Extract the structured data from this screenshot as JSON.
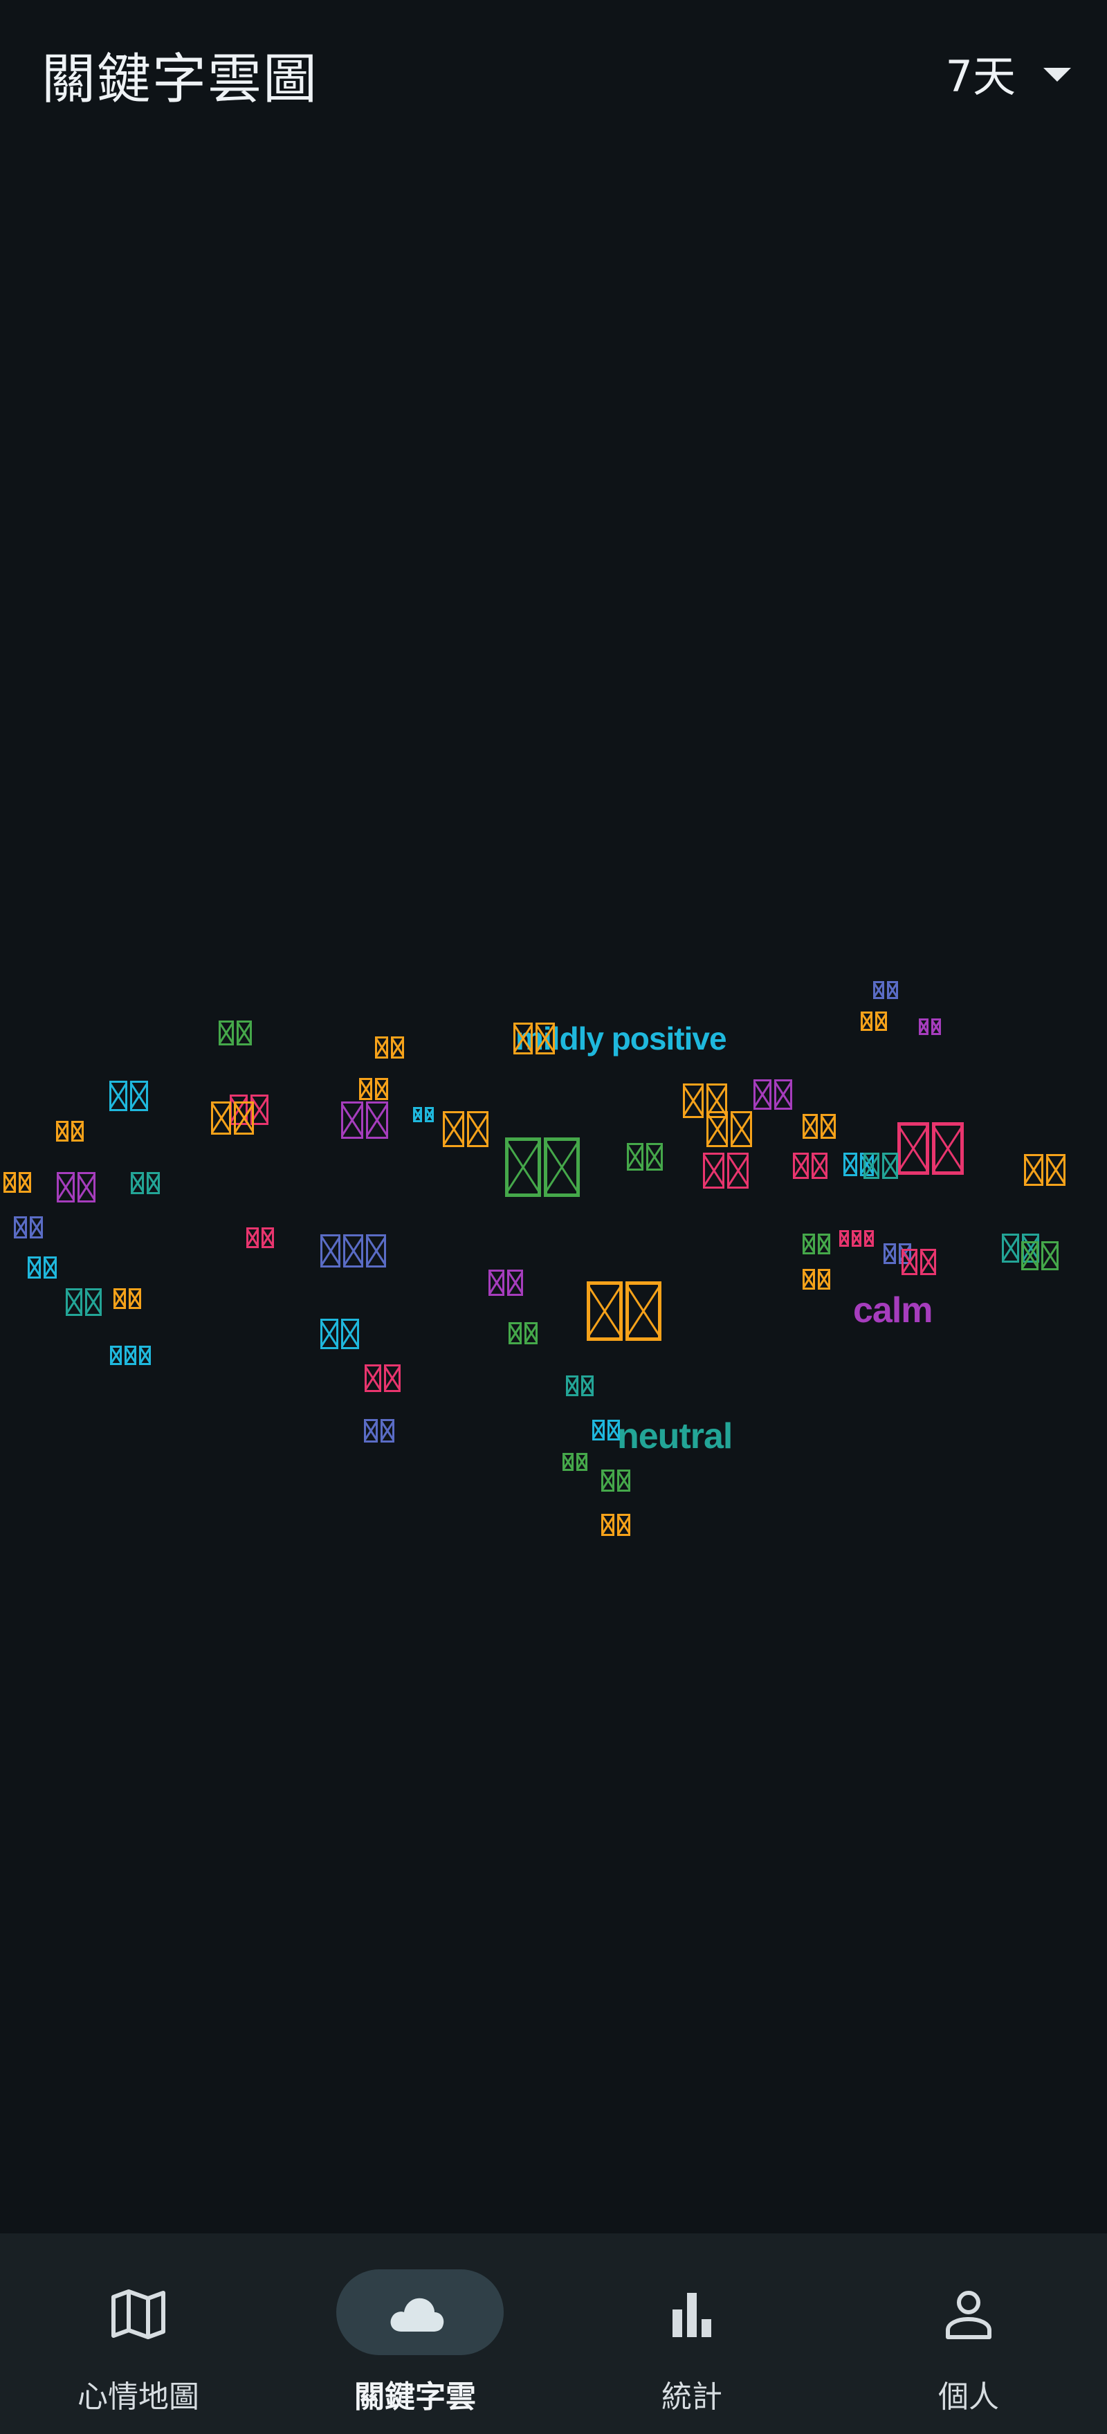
{
  "header": {
    "title": "關鍵字雲圖",
    "range_label": "7天"
  },
  "colors": {
    "background": "#0e1317",
    "nav_background": "#192024",
    "nav_active_pill": "#304048",
    "pink": "#e8356e",
    "orange": "#f6a21a",
    "green": "#45a84a",
    "teal": "#23a597",
    "cyan": "#1fb8dd",
    "purple": "#a63dbd",
    "indigo": "#5a6cc5"
  },
  "word_cloud": {
    "words": [
      {
        "text": "mildly positive",
        "color": "#1fb8dd"
      },
      {
        "text": "calm",
        "color": "#a63dbd"
      },
      {
        "text": "neutral",
        "color": "#23a597"
      },
      {
        "text": "▯▯",
        "color": "#f6a21a"
      },
      {
        "text": "▯▯",
        "color": "#5a6cc5"
      },
      {
        "text": "▯▯",
        "color": "#a63dbd"
      },
      {
        "text": "▯▯",
        "color": "#45a84a"
      },
      {
        "text": "▯▯",
        "color": "#1fb8dd"
      },
      {
        "text": "▯▯",
        "color": "#e8356e"
      },
      {
        "text": "▯▯",
        "color": "#f6a21a"
      },
      {
        "text": "▯▯",
        "color": "#f6a21a"
      },
      {
        "text": "▯▯",
        "color": "#1fb8dd"
      },
      {
        "text": "▯▯",
        "color": "#f6a21a"
      },
      {
        "text": "▯▯",
        "color": "#a63dbd"
      },
      {
        "text": "▯▯",
        "color": "#f6a21a"
      },
      {
        "text": "▯▯",
        "color": "#a63dbd"
      },
      {
        "text": "▯▯",
        "color": "#23a597"
      },
      {
        "text": "▯▯",
        "color": "#f6a21a"
      },
      {
        "text": "▯▯",
        "color": "#a63dbd"
      },
      {
        "text": "▯▯",
        "color": "#f6a21a"
      },
      {
        "text": "▯▯",
        "color": "#f6a21a"
      },
      {
        "text": "▯▯",
        "color": "#f6a21a"
      },
      {
        "text": "▯▯",
        "color": "#45a84a"
      },
      {
        "text": "▯▯",
        "color": "#45a84a"
      },
      {
        "text": "▯▯",
        "color": "#e8356e"
      },
      {
        "text": "▯▯",
        "color": "#1fb8dd"
      },
      {
        "text": "▯▯",
        "color": "#e8356e"
      },
      {
        "text": "▯▯",
        "color": "#f6a21a"
      },
      {
        "text": "▯▯",
        "color": "#e8356e"
      },
      {
        "text": "▯▯",
        "color": "#23a597"
      },
      {
        "text": "▯▯",
        "color": "#23a597"
      },
      {
        "text": "▯▯",
        "color": "#f6a21a"
      },
      {
        "text": "▯▯",
        "color": "#e8356e"
      },
      {
        "text": "▯▯▯",
        "color": "#5a6cc5"
      },
      {
        "text": "▯▯",
        "color": "#45a84a"
      },
      {
        "text": "▯▯▯",
        "color": "#e8356e"
      },
      {
        "text": "▯▯",
        "color": "#5a6cc5"
      },
      {
        "text": "▯▯",
        "color": "#e8356e"
      },
      {
        "text": "▯▯",
        "color": "#45a84a"
      },
      {
        "text": "▯▯",
        "color": "#5a6cc5"
      },
      {
        "text": "▯▯",
        "color": "#1fb8dd"
      },
      {
        "text": "▯▯",
        "color": "#23a597"
      },
      {
        "text": "▯▯",
        "color": "#f6a21a"
      },
      {
        "text": "▯▯",
        "color": "#a63dbd"
      },
      {
        "text": "▯▯",
        "color": "#45a84a"
      },
      {
        "text": "▯▯",
        "color": "#f6a21a"
      },
      {
        "text": "▯▯",
        "color": "#1fb8dd"
      },
      {
        "text": "▯▯",
        "color": "#e8356e"
      },
      {
        "text": "▯▯",
        "color": "#5a6cc5"
      },
      {
        "text": "▯▯",
        "color": "#f6a21a"
      },
      {
        "text": "▯▯",
        "color": "#23a597"
      },
      {
        "text": "▯▯",
        "color": "#1fb8dd"
      },
      {
        "text": "▯▯",
        "color": "#45a84a"
      },
      {
        "text": "▯▯▯",
        "color": "#1fb8dd"
      },
      {
        "text": "▯▯",
        "color": "#45a84a"
      },
      {
        "text": "▯▯",
        "color": "#f6a21a"
      },
      {
        "text": "▯▯",
        "color": "#f6a21a"
      }
    ]
  },
  "bottom_nav": {
    "items": [
      {
        "label": "心情地圖",
        "icon": "map-icon"
      },
      {
        "label": "關鍵字雲",
        "icon": "cloud-icon",
        "active": true
      },
      {
        "label": "統計",
        "icon": "bar-chart-icon"
      },
      {
        "label": "個人",
        "icon": "person-icon"
      }
    ]
  }
}
